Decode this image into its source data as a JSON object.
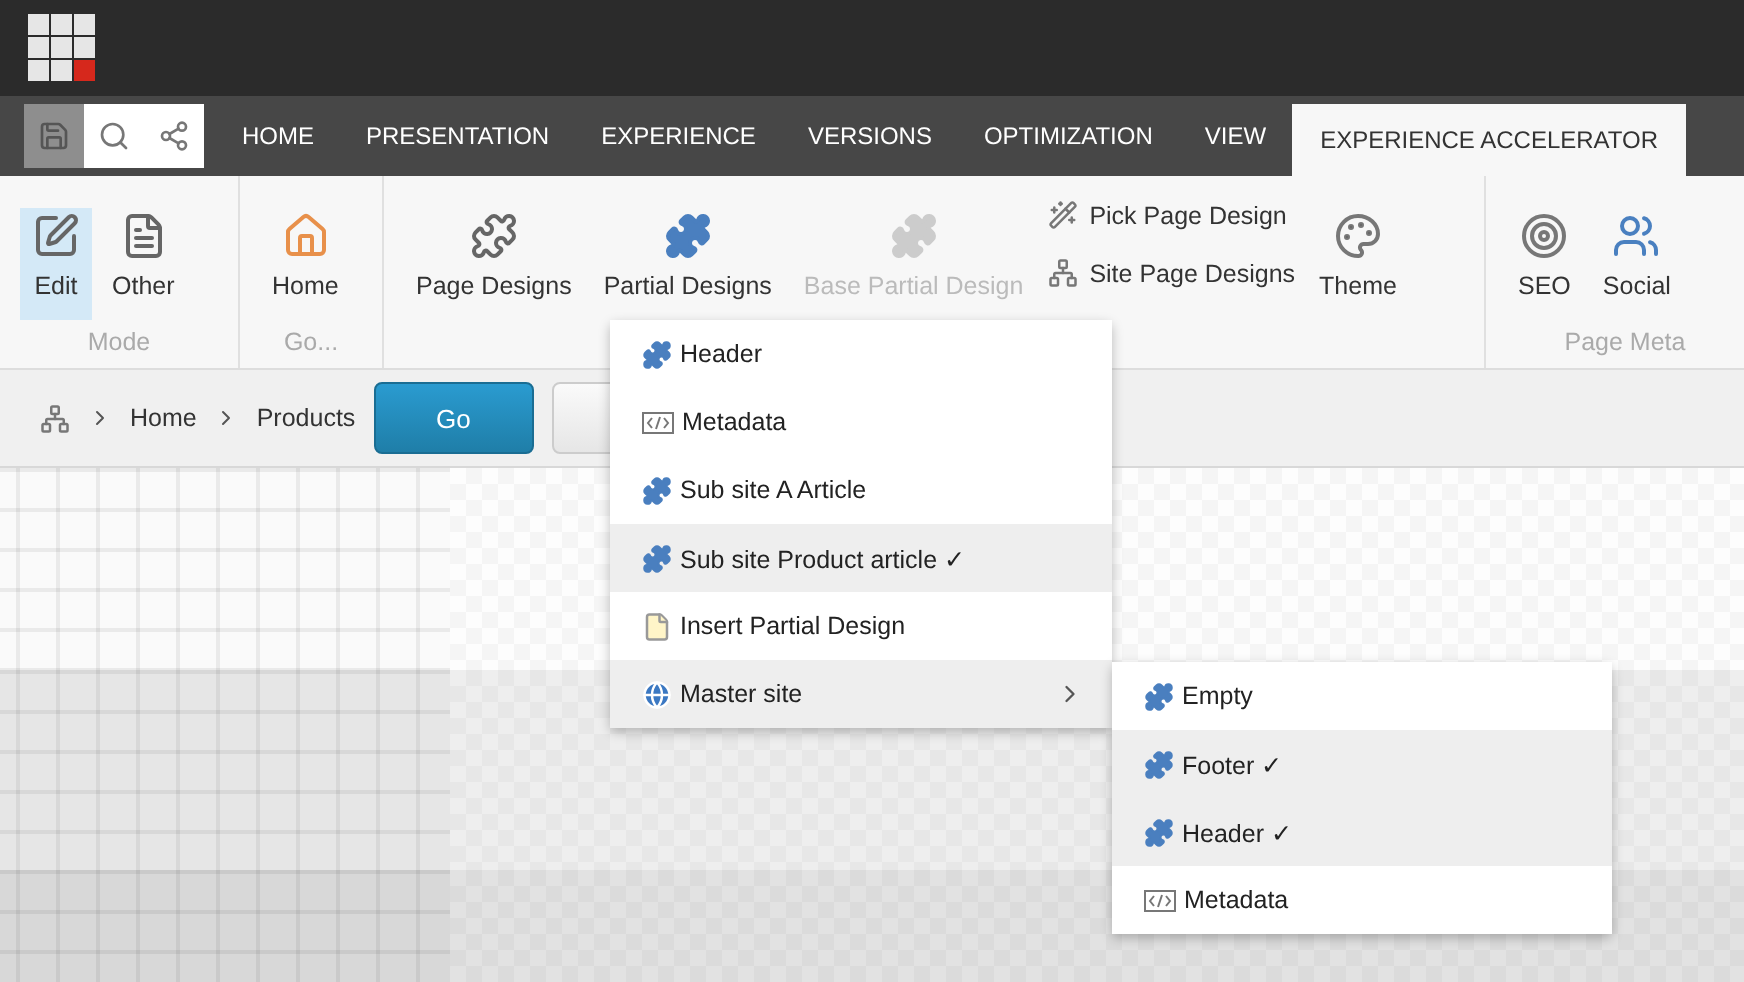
{
  "quick_tools": [
    {
      "kind": "save",
      "selected": true
    },
    {
      "kind": "search",
      "selected": false
    },
    {
      "kind": "share",
      "selected": false
    }
  ],
  "tabs": [
    {
      "label": "HOME",
      "selected": false
    },
    {
      "label": "PRESENTATION",
      "selected": false
    },
    {
      "label": "EXPERIENCE",
      "selected": false
    },
    {
      "label": "VERSIONS",
      "selected": false
    },
    {
      "label": "OPTIMIZATION",
      "selected": false
    },
    {
      "label": "VIEW",
      "selected": false
    },
    {
      "label": "EXPERIENCE ACCELERATOR",
      "selected": true
    }
  ],
  "ribbon_groups": [
    {
      "label": "Mode",
      "items": [
        {
          "kind": "large",
          "label": "Edit",
          "selected": true,
          "disabled": false
        },
        {
          "kind": "large",
          "label": "Other",
          "selected": false,
          "disabled": false
        }
      ]
    },
    {
      "label": "Go...",
      "items": [
        {
          "kind": "large",
          "label": "Home",
          "selected": false,
          "disabled": false
        }
      ]
    },
    {
      "items": [
        {
          "kind": "large",
          "label": "Page Designs",
          "selected": false,
          "disabled": false
        },
        {
          "kind": "large",
          "label": "Partial Designs",
          "selected": false,
          "disabled": false
        },
        {
          "kind": "large",
          "label": "Base Partial Design",
          "selected": false,
          "disabled": true
        },
        {
          "kind": "stack",
          "entries": [
            "Pick Page Design",
            "Site Page Designs"
          ]
        },
        {
          "kind": "large",
          "label": "Theme",
          "selected": false,
          "disabled": false
        }
      ]
    },
    {
      "label": "Page Meta",
      "items": [
        {
          "kind": "large",
          "label": "SEO",
          "selected": false,
          "disabled": false
        },
        {
          "kind": "large",
          "label": "Social",
          "selected": false,
          "disabled": false
        }
      ]
    }
  ],
  "breadcrumb": [
    "Home",
    "Products"
  ],
  "go_button": "Go",
  "menu": [
    {
      "kind": "partial",
      "label": "Header",
      "selected": false,
      "submenu": false
    },
    {
      "kind": "metadata",
      "label": "Metadata",
      "selected": false,
      "submenu": false
    },
    {
      "kind": "partial",
      "label": "Sub site A Article",
      "selected": false,
      "submenu": false
    },
    {
      "kind": "partial",
      "label": "Sub site Product article ✓",
      "selected": true,
      "submenu": false
    },
    {
      "kind": "insert",
      "label": "Insert Partial Design",
      "selected": false,
      "submenu": false
    },
    {
      "kind": "site",
      "label": "Master site",
      "selected": true,
      "submenu": true
    }
  ],
  "submenu": [
    {
      "kind": "partial",
      "label": "Empty",
      "selected": false
    },
    {
      "kind": "partial",
      "label": "Footer ✓",
      "selected": true
    },
    {
      "kind": "partial",
      "label": "Header ✓",
      "selected": true
    },
    {
      "kind": "metadata",
      "label": "Metadata",
      "selected": false
    }
  ]
}
